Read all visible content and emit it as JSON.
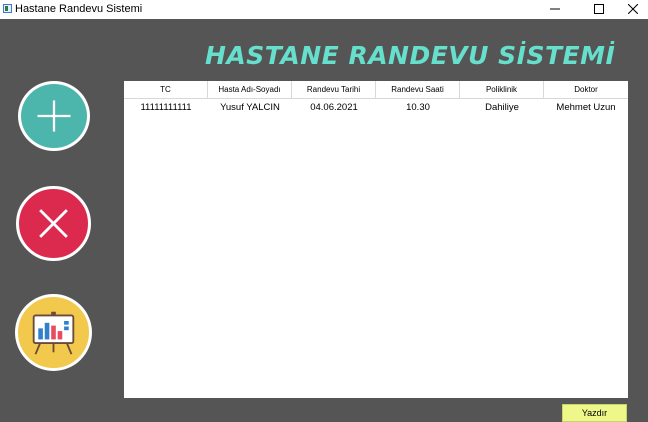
{
  "window": {
    "title": "Hastane Randevu Sistemi",
    "icon": "app-form-icon"
  },
  "banner": {
    "text": "HASTANE RANDEVU SİSTEMİ",
    "color": "#66e0cd"
  },
  "side_buttons": [
    {
      "name": "add",
      "icon": "plus-icon",
      "color": "#4db6ac"
    },
    {
      "name": "delete",
      "icon": "close-icon",
      "color": "#dc2a4e"
    },
    {
      "name": "report",
      "icon": "chart-presentation-icon",
      "color": "#f2c94c"
    }
  ],
  "table": {
    "headers": [
      "TC",
      "Hasta Adı-Soyadı",
      "Randevu Tarihi",
      "Randevu Saati",
      "Poliklinik",
      "Doktor"
    ],
    "rows": [
      [
        "11111111111",
        "Yusuf YALCIN",
        "04.06.2021",
        "10.30",
        "Dahiliye",
        "Mehmet Uzun"
      ]
    ]
  },
  "print_button": {
    "label": "Yazdır",
    "color": "#eef78a"
  }
}
